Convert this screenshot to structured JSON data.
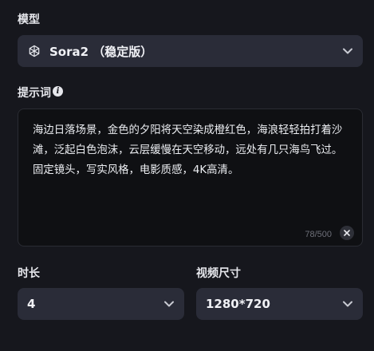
{
  "model": {
    "label": "模型",
    "value": "Sora2 （稳定版）",
    "icon": "openai-icon"
  },
  "prompt": {
    "label": "提示词",
    "info_icon": "info-icon",
    "text": "海边日落场景，金色的夕阳将天空染成橙红色，海浪轻轻拍打着沙滩，泛起白色泡沫，云层缓慢在天空移动，远处有几只海鸟飞过。固定镜头，写实风格，电影质感，4K高清。",
    "counter": "78/500",
    "clear_icon": "close-icon"
  },
  "duration": {
    "label": "时长",
    "value": "4"
  },
  "video_size": {
    "label": "视频尺寸",
    "value": "1280*720"
  },
  "colors": {
    "background": "#16171d",
    "select_bg": "#2a2c38",
    "textarea_bg": "#0f1013"
  }
}
